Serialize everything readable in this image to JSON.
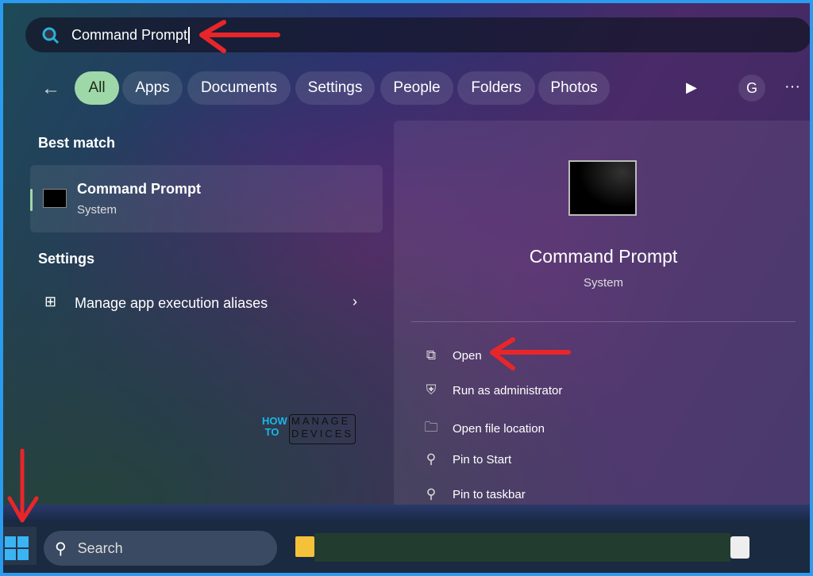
{
  "search": {
    "value": "Command Prompt"
  },
  "filters": [
    {
      "label": "All",
      "active": true
    },
    {
      "label": "Apps"
    },
    {
      "label": "Documents"
    },
    {
      "label": "Settings"
    },
    {
      "label": "People"
    },
    {
      "label": "Folders"
    },
    {
      "label": "Photos"
    }
  ],
  "header_right": {
    "avatar": "G",
    "more": "···"
  },
  "best_match": {
    "heading": "Best match",
    "title": "Command Prompt",
    "subtitle": "System"
  },
  "settings": {
    "heading": "Settings",
    "item": "Manage app execution aliases"
  },
  "preview": {
    "title": "Command Prompt",
    "subtitle": "System",
    "actions": [
      {
        "label": "Open",
        "icon": "open-icon"
      },
      {
        "label": "Run as administrator",
        "icon": "shield-icon"
      },
      {
        "label": "Open file location",
        "icon": "folder-icon"
      },
      {
        "label": "Pin to Start",
        "icon": "pin-icon"
      },
      {
        "label": "Pin to taskbar",
        "icon": "pin-icon"
      }
    ]
  },
  "watermark": {
    "text": "HOW TO MANAGE DEVICES"
  },
  "taskbar": {
    "search_label": "Search"
  },
  "colors": {
    "accent": "#9fd8a8",
    "arrow": "#e8262a",
    "border": "#2b9bef"
  }
}
